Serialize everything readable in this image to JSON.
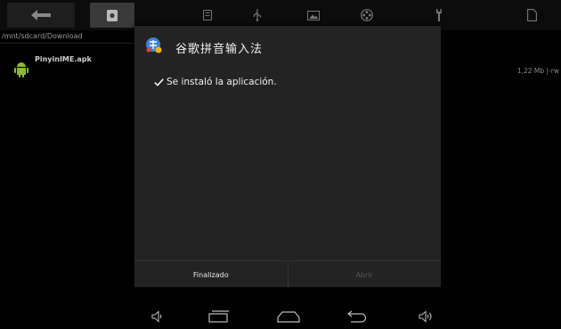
{
  "toolbar": {
    "items": [
      "back-icon",
      "sdcard-icon",
      "storage-icon",
      "usb-icon",
      "image-icon",
      "film-icon",
      "tools-icon",
      "document-icon"
    ]
  },
  "file_list": {
    "path": "/mnt/sdcard/Download",
    "files": [
      {
        "name": "PinyinIME.apk",
        "size": "1,22 Mb  |-rw"
      }
    ]
  },
  "dialog": {
    "app_title": "谷歌拼音输入法",
    "message": "Se instaló la aplicación.",
    "buttons": {
      "done": "Finalizado",
      "open": "Abrir"
    }
  },
  "navbar": {
    "items": [
      "volume-down-icon",
      "recent-apps-icon",
      "home-icon",
      "back-nav-icon",
      "volume-up-icon"
    ]
  }
}
